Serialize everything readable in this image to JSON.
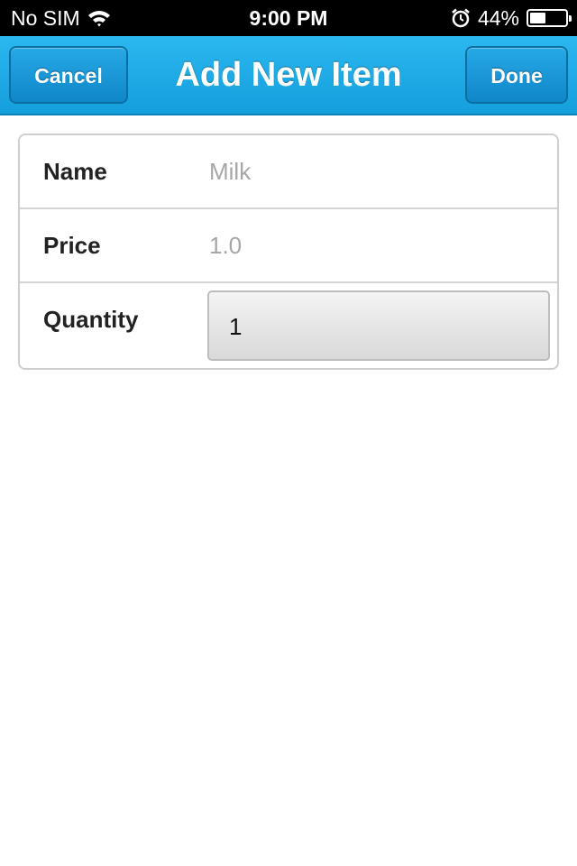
{
  "status_bar": {
    "carrier": "No SIM",
    "time": "9:00 PM",
    "battery_text": "44%",
    "battery_level": 0.44,
    "icons": [
      "wifi-icon",
      "alarm-icon",
      "battery-icon"
    ]
  },
  "nav": {
    "title": "Add New Item",
    "cancel_label": "Cancel",
    "done_label": "Done",
    "accent_color": "#1ba9e8"
  },
  "form": {
    "fields": [
      {
        "label": "Name",
        "value": "Milk"
      },
      {
        "label": "Price",
        "value": "1.0"
      },
      {
        "label": "Quantity",
        "value": "1"
      }
    ]
  }
}
